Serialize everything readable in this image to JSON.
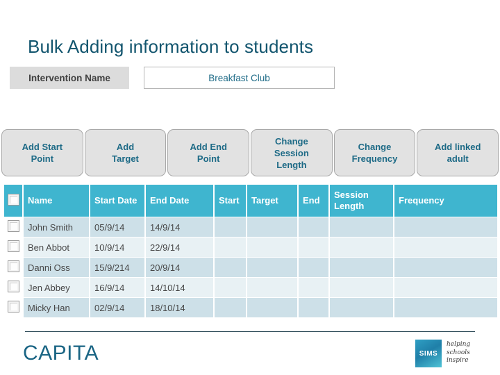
{
  "slide": {
    "title": "Bulk Adding information to students"
  },
  "intervention": {
    "label": "Intervention Name",
    "value": "Breakfast Club"
  },
  "actions": [
    {
      "name": "add-start-point",
      "label": "Add Start\nPoint"
    },
    {
      "name": "add-target",
      "label": "Add\nTarget"
    },
    {
      "name": "add-end-point",
      "label": "Add End\nPoint"
    },
    {
      "name": "change-session-length",
      "label": "Change\nSession\nLength"
    },
    {
      "name": "change-frequency",
      "label": "Change\nFrequency"
    },
    {
      "name": "add-linked-adult",
      "label": "Add linked\nadult"
    }
  ],
  "grid": {
    "columns": [
      {
        "key": "check",
        "label": ""
      },
      {
        "key": "name",
        "label": "Name"
      },
      {
        "key": "start_date",
        "label": "Start Date"
      },
      {
        "key": "end_date",
        "label": "End Date"
      },
      {
        "key": "start",
        "label": "Start"
      },
      {
        "key": "target",
        "label": "Target"
      },
      {
        "key": "end",
        "label": "End"
      },
      {
        "key": "session_length",
        "label": "Session Length"
      },
      {
        "key": "frequency",
        "label": "Frequency"
      }
    ],
    "rows": [
      {
        "name": "John Smith",
        "start_date": "05/9/14",
        "end_date": "14/9/14",
        "start": "",
        "target": "",
        "end": "",
        "session_length": "",
        "frequency": ""
      },
      {
        "name": "Ben Abbot",
        "start_date": "10/9/14",
        "end_date": "22/9/14",
        "start": "",
        "target": "",
        "end": "",
        "session_length": "",
        "frequency": ""
      },
      {
        "name": "Danni Oss",
        "start_date": "15/9/214",
        "end_date": "20/9/14",
        "start": "",
        "target": "",
        "end": "",
        "session_length": "",
        "frequency": ""
      },
      {
        "name": "Jen Abbey",
        "start_date": "16/9/14",
        "end_date": "14/10/14",
        "start": "",
        "target": "",
        "end": "",
        "session_length": "",
        "frequency": ""
      },
      {
        "name": "Micky Han",
        "start_date": "02/9/14",
        "end_date": "18/10/14",
        "start": "",
        "target": "",
        "end": "",
        "session_length": "",
        "frequency": ""
      }
    ]
  },
  "footer": {
    "capita_wordmark": "CAPITA",
    "sims_mark": "SIMS",
    "sims_tagline": "helping\nschools\ninspire"
  },
  "colors": {
    "title_teal": "#12556e",
    "header_teal": "#3fb5cf",
    "row_odd": "#cde0e8",
    "row_even": "#e8f1f4",
    "button_face": "#e2e2e2",
    "button_text": "#1d6a86",
    "capita_blue": "#1a6584"
  }
}
